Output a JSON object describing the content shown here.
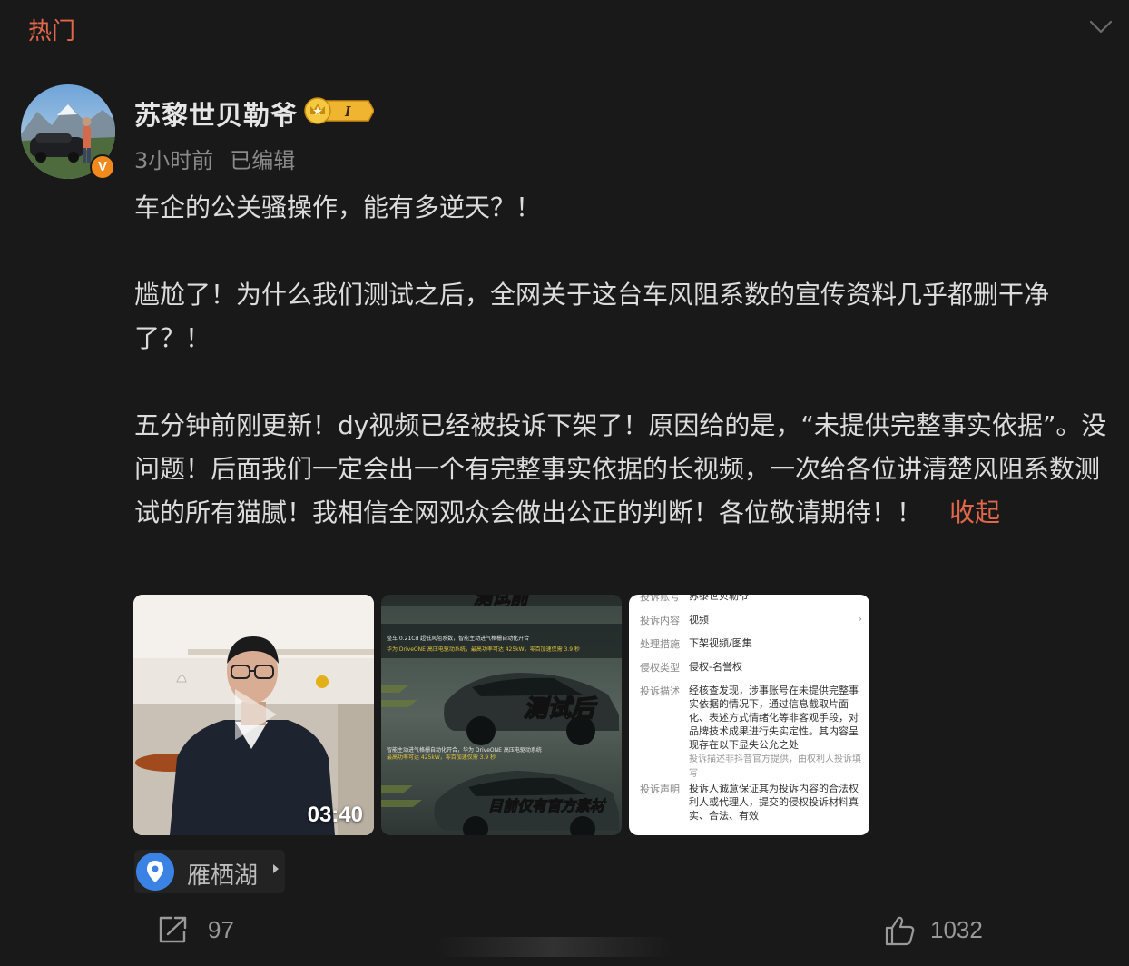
{
  "header": {
    "tab_label": "热门"
  },
  "post": {
    "author": "苏黎世贝勒爷",
    "rank_badge": "I",
    "verified_mark": "V",
    "time": "3小时前",
    "edited": "已编辑",
    "paragraphs": [
      "车企的公关骚操作，能有多逆天？！",
      "尴尬了！为什么我们测试之后，全网关于这台车风阻系数的宣传资料几乎都删干净了？！",
      "五分钟前刚更新！dy视频已经被投诉下架了！原因给的是，“未提供完整事实依据”。没问题！后面我们一定会出一个有完整事实依据的长视频，一次给各位讲清楚风阻系数测试的所有猫腻！我相信全网观众会做出公正的判断！各位敬请期待！！"
    ],
    "collapse_label": "收起",
    "media": {
      "video_duration": "03:40",
      "image2": {
        "top_caption": "测试前",
        "spec_line1": "整车 0.21Cd 超低风阻系数，智能主动进气格栅自动化开合",
        "spec_line2": "华为 DriveONE 高压电驱动系统，最高功率可达 425kW，零百加速仅需 3.9 秒",
        "middle_caption": "测试后",
        "spec_line3": "智能主动进气格栅自动化开合，华为 DriveONE 高压电驱动系统",
        "spec_line4": "最高功率可达 425kW，零百加速仅需 3.9 秒",
        "bottom_caption": "目前仅有官方素材"
      },
      "image3": {
        "rows": [
          {
            "label": "投诉账号",
            "value": "苏黎世贝勒爷"
          },
          {
            "label": "投诉内容",
            "value": "视频",
            "chevron": "›"
          },
          {
            "label": "处理措施",
            "value": "下架视频/图集"
          },
          {
            "label": "侵权类型",
            "value": "侵权-名誉权"
          },
          {
            "label": "投诉描述",
            "value": "经核查发现，涉事账号在未提供完整事实依据的情况下，通过信息截取片面化、表述方式情绪化等非客观手段，对品牌技术成果进行失实定性。其内容呈现存在以下显失公允之处",
            "note": "投诉描述非抖音官方提供，由权利人投诉填写"
          },
          {
            "label": "投诉声明",
            "value": "投诉人诚意保证其为投诉内容的合法权利人或代理人，提交的侵权投诉材料真实、合法、有效"
          }
        ]
      }
    },
    "location": "雁栖湖",
    "actions": {
      "repost_count": "97",
      "like_count": "1032"
    }
  },
  "colors": {
    "background": "#191919",
    "accent": "#e0674a",
    "verified": "#f08a1c",
    "location_pin": "#3b82e5"
  },
  "icons": [
    "chevron-down-icon",
    "verified-icon",
    "crown-rank-icon",
    "play-icon",
    "location-pin-icon",
    "share-icon",
    "thumbs-up-icon"
  ]
}
